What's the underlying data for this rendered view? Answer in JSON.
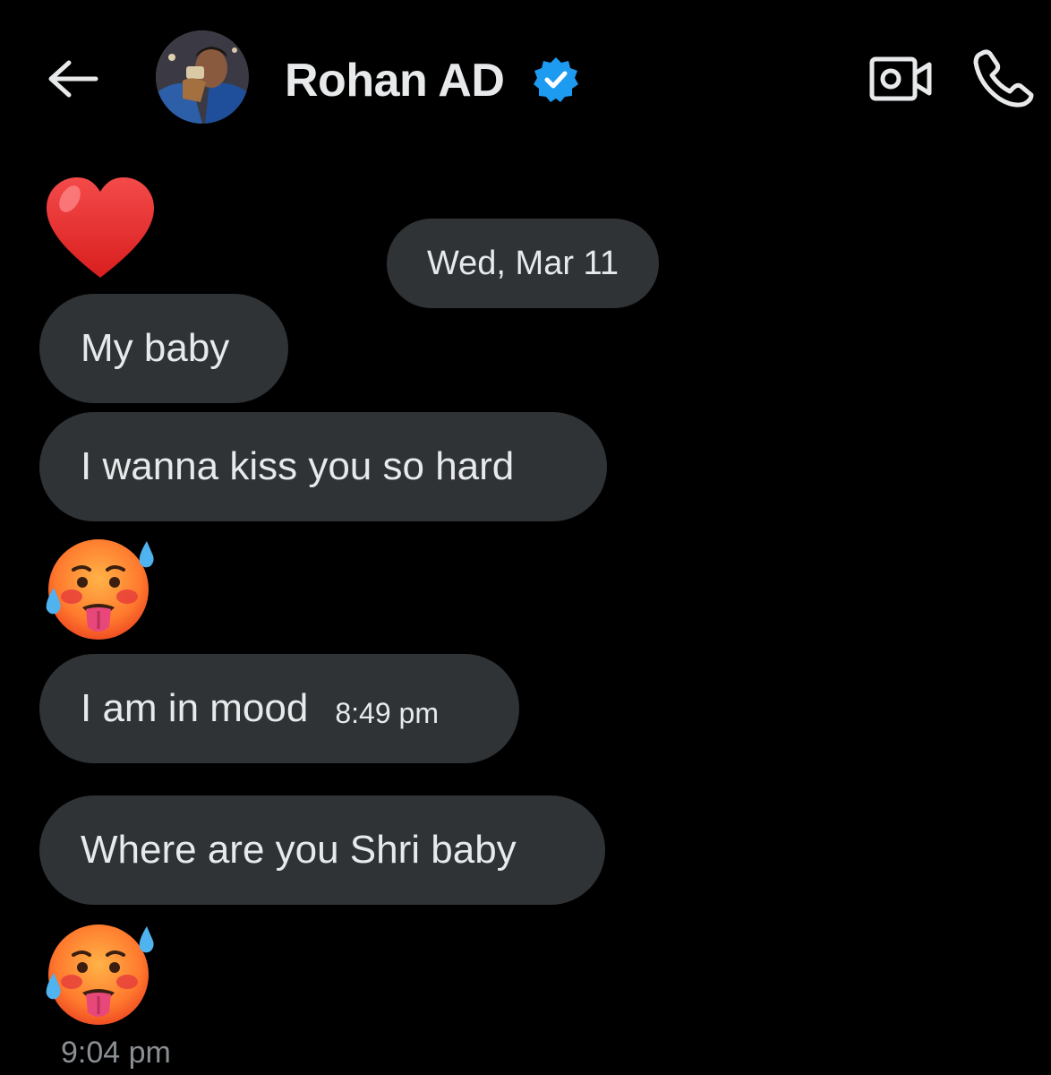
{
  "header": {
    "back_icon": "arrow-left-icon",
    "contact_name": "Rohan AD",
    "verified_icon": "verified-badge-icon",
    "verified_color": "#1d9bf0",
    "video_icon": "video-camera-icon",
    "call_icon": "phone-icon"
  },
  "conversation": {
    "date_separator": "Wed, Mar 11",
    "messages": [
      {
        "type": "emoji",
        "emoji": "red-heart-emoji"
      },
      {
        "type": "text",
        "text": "My baby"
      },
      {
        "type": "text",
        "text": "I wanna kiss you so hard"
      },
      {
        "type": "emoji",
        "emoji": "hot-face-emoji"
      },
      {
        "type": "text",
        "text": "I am in mood",
        "time": "8:49 pm"
      },
      {
        "type": "text",
        "text": "Where are you Shri baby"
      },
      {
        "type": "emoji",
        "emoji": "hot-face-emoji"
      }
    ],
    "last_timestamp": "9:04 pm"
  },
  "colors": {
    "background": "#000000",
    "bubble": "#2f3336",
    "text": "#e7e9ea",
    "muted_text": "#8b8f94"
  }
}
